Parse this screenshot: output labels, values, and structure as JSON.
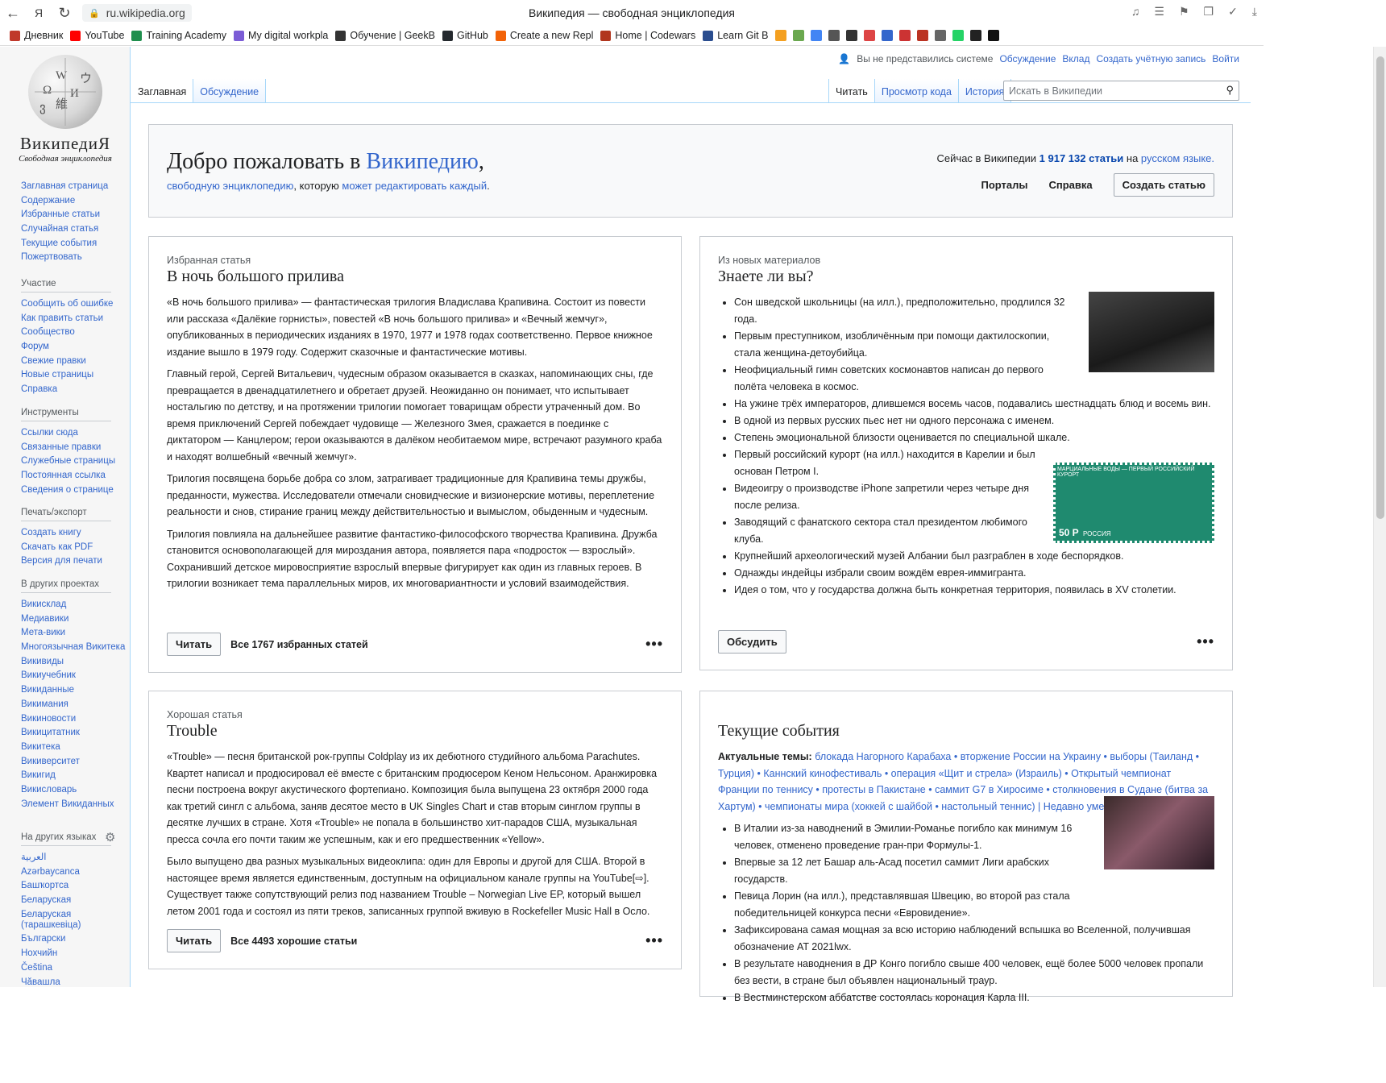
{
  "browser": {
    "address": "ru.wikipedia.org",
    "title": "Википедия — свободная энциклопедия"
  },
  "bookmarks": [
    {
      "label": "Дневник",
      "color": "#c0392b"
    },
    {
      "label": "YouTube",
      "color": "#ff0000"
    },
    {
      "label": "Training Academy",
      "color": "#1f8f4e"
    },
    {
      "label": "My digital workpla",
      "color": "#7b5cd6"
    },
    {
      "label": "Обучение | GeekB",
      "color": "#333333"
    },
    {
      "label": "GitHub",
      "color": "#24292e"
    },
    {
      "label": "Create a new Repl",
      "color": "#f26207"
    },
    {
      "label": "Home | Codewars",
      "color": "#b1361e"
    },
    {
      "label": "Learn Git B",
      "color": "#2a4d8f"
    }
  ],
  "sidebar": {
    "logo": {
      "wordmark": "ВикипедиЯ",
      "tagline": "Свободная энциклопедия"
    },
    "main": [
      "Заглавная страница",
      "Содержание",
      "Избранные статьи",
      "Случайная статья",
      "Текущие события",
      "Пожертвовать"
    ],
    "participation": {
      "title": "Участие",
      "items": [
        "Сообщить об ошибке",
        "Как править статьи",
        "Сообщество",
        "Форум",
        "Свежие правки",
        "Новые страницы",
        "Справка"
      ]
    },
    "tools": {
      "title": "Инструменты",
      "items": [
        "Ссылки сюда",
        "Связанные правки",
        "Служебные страницы",
        "Постоянная ссылка",
        "Сведения о странице"
      ]
    },
    "print": {
      "title": "Печать/экспорт",
      "items": [
        "Создать книгу",
        "Скачать как PDF",
        "Версия для печати"
      ]
    },
    "projects": {
      "title": "В других проектах",
      "items": [
        "Викисклад",
        "Медиавики",
        "Мета-вики",
        "Многоязычная Викитека",
        "Викивиды",
        "Викиучебник",
        "Викиданные",
        "Викимания",
        "Викиновости",
        "Викицитатник",
        "Викитека",
        "Викиверситет",
        "Викигид",
        "Викисловарь",
        "Элемент Викиданных"
      ]
    },
    "languages": {
      "title": "На других языках",
      "items": [
        "العربية",
        "Azərbaycanca",
        "Башҡортса",
        "Беларуская",
        "Беларуская (тарашкевіца)",
        "Български",
        "Нохчийн",
        "Čeština",
        "Чӑвашла"
      ]
    }
  },
  "header": {
    "user_status": "Вы не представились системе",
    "personal_links": [
      "Обсуждение",
      "Вклад",
      "Создать учётную запись",
      "Войти"
    ],
    "left_tabs": [
      "Заглавная",
      "Обсуждение"
    ],
    "right_tabs": [
      "Читать",
      "Просмотр кода",
      "История"
    ],
    "search_placeholder": "Искать в Википедии"
  },
  "welcome": {
    "title_prefix": "Добро пожаловать в ",
    "title_link": "Википедию",
    "title_suffix": ",",
    "sub_link1": "свободную энциклопедию",
    "sub_mid": ", которую ",
    "sub_link2": "может редактировать каждый",
    "sub_end": ".",
    "stat_prefix": "Сейчас в Википедии ",
    "stat_count": "1 917 132 статьи",
    "stat_mid": " на ",
    "stat_lang": "русском языке.",
    "links": [
      "Порталы",
      "Справка"
    ],
    "create_button": "Создать статью"
  },
  "featured": {
    "kicker": "Избранная статья",
    "title": "В ночь большого прилива",
    "p1": "«В ночь большого прилива» — фантастическая трилогия Владислава Крапивина. Состоит из повести или рассказа «Далёкие горнисты», повестей «В ночь большого прилива» и «Вечный жемчуг», опубликованных в периодических изданиях в 1970, 1977 и 1978 годах соответственно. Первое книжное издание вышло в 1979 году. Содержит сказочные и фантастические мотивы.",
    "p2": "Главный герой, Сергей Витальевич, чудесным образом оказывается в сказках, напоминающих сны, где превращается в двенадцатилетнего и обретает друзей. Неожиданно он понимает, что испытывает ностальгию по детству, и на протяжении трилогии помогает товарищам обрести утраченный дом. Во время приключений Сергей побеждает чудовище — Железного Змея, сражается в поединке с диктатором — Канцлером; герои оказываются в далёком необитаемом мире, встречают разумного краба и находят волшебный «вечный жемчуг».",
    "p3": "Трилогия посвящена борьбе добра со злом, затрагивает традиционные для Крапивина темы дружбы, преданности, мужества. Исследователи отмечали сновидческие и визионерские мотивы, переплетение реальности и снов, стирание границ между действительностью и вымыслом, обыденным и чудесным.",
    "p4": "Трилогия повлияла на дальнейшее развитие фантастико-философского творчества Крапивина. Дружба становится основополагающей для мироздания автора, появляется пара «подросток — взрослый». Сохранивший детское мировосприятие взрослый впервые фигурирует как один из главных героев. В трилогии возникает тема параллельных миров, их многовариантности и условий взаимодействия.",
    "read": "Читать",
    "all": "Все 1767 избранных статей"
  },
  "dyk": {
    "kicker": "Из новых материалов",
    "title": "Знаете ли вы?",
    "items": [
      "Сон шведской школьницы (на илл.), предположительно, продлился 32 года.",
      "Первым преступником, изобличённым при помощи дактилоскопии, стала женщина-детоубийца.",
      "Неофициальный гимн советских космонавтов написан до первого полёта человека в космос.",
      "На ужине трёх императоров, длившемся восемь часов, подавались шестнадцать блюд и восемь вин.",
      "В одной из первых русских пьес нет ни одного персонажа с именем.",
      "Степень эмоциональной близости оценивается по специальной шкале.",
      "Первый российский курорт (на илл.) находится в Карелии и был основан Петром I.",
      "Видеоигру о производстве iPhone запретили через четыре дня после релиза.",
      "Заводящий с фанатского сектора стал президентом любимого клуба.",
      "Крупнейший археологический музей Албании был разграблен в ходе беспорядков.",
      "Однажды индейцы избрали своим вождём еврея-иммигранта.",
      "Идея о том, что у государства должна быть конкретная территория, появилась в XV столетии."
    ],
    "stamp_text": "МАРЦИАЛЬНЫЕ ВОДЫ — ПЕРВЫЙ РОССИЙСКИЙ КУРОРТ",
    "stamp_value": "50 Р",
    "stamp_country": "РОССИЯ",
    "button": "Обсудить"
  },
  "good": {
    "kicker": "Хорошая статья",
    "title": "Trouble",
    "p1": "«Trouble» — песня британской рок-группы Coldplay из их дебютного студийного альбома Parachutes. Квартет написал и продюсировал её вместе с британским продюсером Кеном Нельсоном. Аранжировка песни построена вокруг акустического фортепиано. Композиция была выпущена 23 октября 2000 года как третий сингл с альбома, заняв десятое место в UK Singles Chart и став вторым синглом группы в десятке лучших в стране. Хотя «Trouble» не попала в большинство хит-парадов США, музыкальная пресса сочла его почти таким же успешным, как и его предшественник «Yellow».",
    "p2": "Было выпущено два разных музыкальных видеоклипа: один для Европы и другой для США. Второй в настоящее время является единственным, доступным на официальном канале группы на YouTube[⇨]. Существует также сопутствующий релиз под названием Trouble – Norwegian Live EP, который вышел летом 2001 года и состоял из пяти треков, записанных группой вживую в Rockefeller Music Hall в Осло.",
    "read": "Читать",
    "all": "Все 4493 хорошие статьи"
  },
  "news": {
    "title": "Текущие события",
    "topics_label": "Актуальные темы:",
    "topics": "блокада Нагорного Карабаха • вторжение России на Украину • выборы (Таиланд • Турция) • Каннский кинофестиваль • операция «Щит и стрела» (Израиль) • Открытый чемпионат Франции по теннису • протесты в Пакистане • саммит G7 в Хиросиме • столкновения в Судане (битва за Хартум) • чемпионаты мира (хоккей с шайбой • настольный теннис) | Недавно умершие",
    "items": [
      "В Италии из-за наводнений в Эмилии-Романье погибло как минимум 16 человек, отменено проведение гран-при Формулы-1.",
      "Впервые за 12 лет Башар аль-Асад посетил саммит Лиги арабских государств.",
      "Певица Лорин (на илл.), представлявшая Швецию, во второй раз стала победительницей конкурса песни «Евровидение».",
      "Зафиксирована самая мощная за всю историю наблюдений вспышка во Вселенной, получившая обозначение AT 2021lwx.",
      "В результате наводнения в ДР Конго погибло свыше 400 человек, ещё более 5000 человек пропали без вести, в стране был объявлен национальный траур.",
      "В Вестминстерском аббатстве состоялась коронация Карла III."
    ]
  }
}
